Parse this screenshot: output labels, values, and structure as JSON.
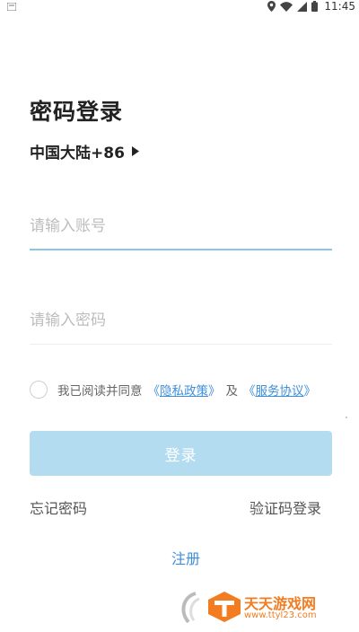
{
  "status_bar": {
    "time": "11:45"
  },
  "page": {
    "title": "密码登录",
    "region_label": "中国大陆+86"
  },
  "account": {
    "placeholder": "请输入账号",
    "value": ""
  },
  "password": {
    "placeholder": "请输入密码",
    "value": ""
  },
  "agreement": {
    "prefix": "我已阅读并同意",
    "privacy_link_open": "《",
    "privacy_link": "隐私政策",
    "privacy_link_close": "》",
    "and_text": "及",
    "service_link_open": "《",
    "service_link": "服务协议",
    "service_link_close": "》",
    "checked": false
  },
  "buttons": {
    "login": "登录",
    "forgot_password": "忘记密码",
    "code_login": "验证码登录",
    "register": "注册"
  },
  "watermark": {
    "line1": "天天游戏网",
    "line2": "www.ttyl23.com"
  },
  "colors": {
    "accent": "#3d8fdc",
    "login_button_bg": "#b3dcf1",
    "active_underline": "#8cc5e8",
    "watermark": "#f47c20"
  }
}
